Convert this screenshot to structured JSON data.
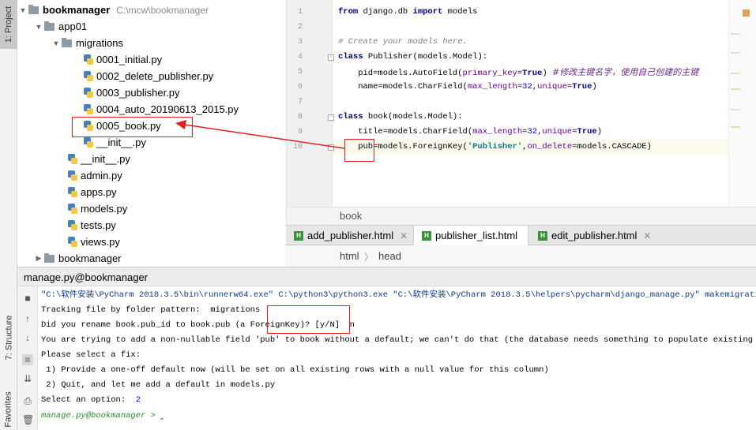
{
  "left_strip": {
    "project_label": "1: Project",
    "structure_label": "7: Structure",
    "favorites_label": "Favorites"
  },
  "tree": {
    "root_name": "bookmanager",
    "root_path": "C:\\mcw\\bookmanager",
    "app_folder": "app01",
    "migrations_folder": "migrations",
    "migration_files": [
      "0001_initial.py",
      "0002_delete_publisher.py",
      "0003_publisher.py",
      "0004_auto_20190613_2015.py",
      "0005_book.py",
      "__init__.py"
    ],
    "app_files": [
      "__init__.py",
      "admin.py",
      "apps.py",
      "models.py",
      "tests.py",
      "views.py"
    ],
    "project_folder": "bookmanager"
  },
  "editor": {
    "line_numbers": [
      "1",
      "2",
      "3",
      "4",
      "5",
      "6",
      "7",
      "8",
      "9",
      "10"
    ],
    "l1_from": "from",
    "l1_mod": " django.db ",
    "l1_import": "import",
    "l1_name": " models",
    "l3_comment": "# Create your models here.",
    "l4_class": "class",
    "l4_rest": " Publisher(models.Model):",
    "l5_a": "    pid=models.AutoField(",
    "l5_param": "primary_key",
    "l5_eq": "=",
    "l5_true": "True",
    "l5_close": ") ",
    "l5_comment": "#修改主键名字，使用自己创建的主键",
    "l6_a": "    name=models.CharField(",
    "l6_param1": "max_length",
    "l6_eq1": "=",
    "l6_num": "32",
    "l6_comma": ",",
    "l6_param2": "unique",
    "l6_eq2": "=",
    "l6_true": "True",
    "l6_close": ")",
    "l8_class": "class",
    "l8_rest": " book(models.Model):",
    "l9_a": "    title=models.CharField(",
    "l9_param1": "max_length",
    "l9_eq1": "=",
    "l9_num": "32",
    "l9_comma": ",",
    "l9_param2": "unique",
    "l9_eq2": "=",
    "l9_true": "True",
    "l9_close": ")",
    "l10_a": "    pub=models.ForeignKey(",
    "l10_str": "'Publisher'",
    "l10_comma": ",",
    "l10_param": "on_delete",
    "l10_rest": "=models.CASCADE)",
    "breadcrumb": "book"
  },
  "tabs": [
    {
      "label": "add_publisher.html",
      "icon": "H"
    },
    {
      "label": "publisher_list.html",
      "icon": "H"
    },
    {
      "label": "edit_publisher.html",
      "icon": "H"
    }
  ],
  "html_breadcrumb": {
    "html": "html",
    "head": "head"
  },
  "run": {
    "title": "manage.py@bookmanager",
    "lines": {
      "cmd": "\"C:\\软件安装\\PyCharm 2018.3.5\\bin\\runnerw64.exe\" C:\\python3\\python3.exe \"C:\\软件安装\\PyCharm 2018.3.5\\helpers\\pycharm\\django_manage.py\" makemigrations",
      "tracking": "Tracking file by folder pattern:  migrations",
      "rename_q": "Did you rename book.pub_id to book.pub (a ForeignKey)? [y/N]  ",
      "rename_a": "n",
      "nonnull": "You are trying to add a non-nullable field 'pub' to book without a default; we can't do that (the database needs something to populate existing rows).",
      "select_fix": "Please select a fix:",
      "opt1": " 1) Provide a one-off default now (will be set on all existing rows with a null value for this column)",
      "opt2": " 2) Quit, and let me add a default in models.py",
      "select_opt": "Select an option:  ",
      "select_ans": "2",
      "prompt": "manage.py@bookmanager > "
    }
  },
  "colors": {
    "keyword": "#000080",
    "string": "#008080",
    "number": "#0000ff",
    "param": "#660099",
    "annotation": "#e02020"
  }
}
